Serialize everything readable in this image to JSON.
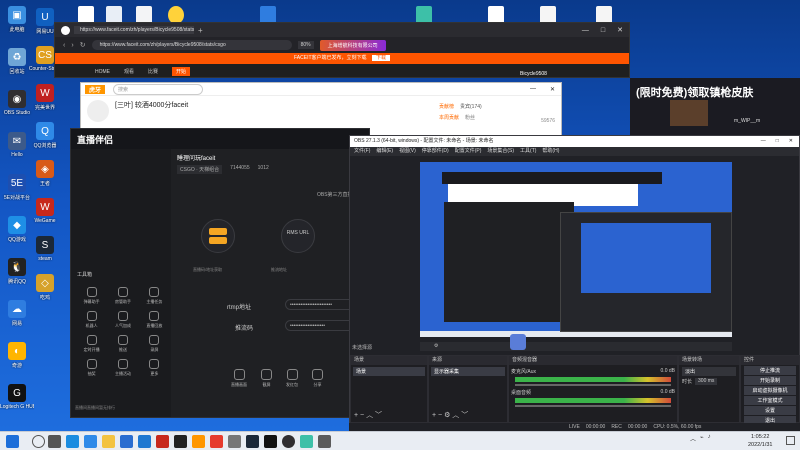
{
  "desktop": {
    "left_icons": [
      {
        "label": "此电脑",
        "color": "#3a8fe0",
        "glyph": "▣"
      },
      {
        "label": "回收站",
        "color": "#6fa6d6",
        "glyph": "♻"
      },
      {
        "label": "OBS Studio",
        "color": "#302e31",
        "glyph": "◉"
      },
      {
        "label": "Hello",
        "color": "#3c5a8a",
        "glyph": "✉"
      },
      {
        "label": "5E对战平台",
        "color": "#1d4fb0",
        "glyph": "5E"
      },
      {
        "label": "QQ游戏",
        "color": "#1e8fe6",
        "glyph": "◆"
      },
      {
        "label": "腾讯QQ",
        "color": "#222",
        "glyph": "🐧"
      },
      {
        "label": "网易",
        "color": "#2f7de0",
        "glyph": "☁"
      },
      {
        "label": "奇游",
        "color": "#ffb500",
        "glyph": "◐"
      },
      {
        "label": "Logitech G HUB",
        "color": "#111",
        "glyph": "G"
      }
    ],
    "col2_icons": [
      {
        "label": "网易UU",
        "color": "#1060c0",
        "glyph": "U"
      },
      {
        "label": "Counter-Strike",
        "color": "#e0a020",
        "glyph": "CS"
      },
      {
        "label": "完美世界",
        "color": "#c02020",
        "glyph": "W"
      },
      {
        "label": "QQ浏览器",
        "color": "#2f8ae8",
        "glyph": "Q"
      },
      {
        "label": "王者",
        "color": "#d85a18",
        "glyph": "◈"
      },
      {
        "label": "WeGame",
        "color": "#c7281c",
        "glyph": "W"
      },
      {
        "label": "steam",
        "color": "#1b2838",
        "glyph": "S"
      },
      {
        "label": "吃鸡",
        "color": "#d6a22c",
        "glyph": "◇"
      }
    ]
  },
  "browser": {
    "tab_title": "https://www.faceit.com/zh/players/Bicycle9508/stats/csgo",
    "url": "https://www.faceit.com/zh/players/Bicycle9508/stats/csgo",
    "zoom": "80%",
    "banner_text": "上海增航科技有限公司",
    "faceit_notice": "FACEIT客户端已发布，立刻下载",
    "faceit_download": "下载",
    "faceit_nav": [
      "HOME",
      "观看",
      "比赛",
      "开始"
    ],
    "faceit_player": "Bicycle9508",
    "side_ad": "(限时免费)领取镇枪皮肤",
    "side_user": "m_WIP__m"
  },
  "huya": {
    "logo": "虎牙",
    "room_title": "[三叶] 较酒4000分faceit",
    "search_placeholder": "搜索",
    "tabs": [
      "贡献榜",
      "贵宾(174)"
    ],
    "active_tab": "本周贡献",
    "sub_tabs": [
      "本周贡献",
      "粉丝"
    ],
    "count": "59576"
  },
  "streamer_tool": {
    "logo": "直播伴侣",
    "room_title": "睡理问玩faceit",
    "category": "CSGO · 天梯组合",
    "stats": [
      "7144055",
      "1012"
    ],
    "left_note": "OBS第三方直播",
    "nodes": [
      "服务器",
      "RMS URL",
      "推流"
    ],
    "node_labels": [
      "直播码/地址获取",
      "推流地址"
    ],
    "rtmp_label": "rtmp地址",
    "rtmp_value": "••••••••••••••••••••••••",
    "key_label": "推流码",
    "key_value": "••••••••••••••••••••",
    "tools_title": "工具箱",
    "tools": [
      "弹幕助手",
      "房管助手",
      "主播任务",
      "机器人",
      "人气加成",
      "直播回放",
      "定时开播",
      "推送",
      "录屏",
      "抽奖",
      "主播活动",
      "更多"
    ],
    "footer_note": "直播间直播间暂无排行",
    "bottom_tools": [
      "直播画面",
      "截屏",
      "发红包",
      "分享"
    ],
    "right_link": "OBS第三方直"
  },
  "obs": {
    "title": "OBS 27.1.3 (64-bit, windows) - 配置文件: 未命名 - 场景: 未命名",
    "menu": [
      "文件(F)",
      "编辑(E)",
      "视图(V)",
      "停靠部件(D)",
      "配置文件(P)",
      "场景集合(S)",
      "工具(T)",
      "帮助(H)"
    ],
    "docks": {
      "scenes": {
        "title": "场景",
        "items": [
          "场景"
        ]
      },
      "sources": {
        "title": "来源",
        "items": [
          "显示器采集"
        ]
      },
      "mixer": {
        "title": "音频混音器",
        "channels": [
          {
            "name": "麦克风/Aux",
            "db": "0.0 dB"
          },
          {
            "name": "桌面音频",
            "db": "0.0 dB"
          }
        ]
      },
      "transitions": {
        "title": "场景转场",
        "type": "淡出",
        "duration_label": "时长",
        "duration": "300 ms"
      },
      "controls": {
        "title": "控件",
        "buttons": [
          "停止推流",
          "开始录制",
          "启动虚拟摄像机",
          "工作室模式",
          "设置",
          "退出"
        ]
      }
    },
    "status": {
      "live_label": "LIVE",
      "live_time": "00:00:00",
      "rec_label": "REC",
      "rec_time": "00:00:00",
      "cpu": "CPU: 0.5%, 60.00 fps"
    },
    "no_source": "未选择源"
  },
  "taskbar": {
    "time": "1:05:22",
    "date": "2022/1/31"
  }
}
